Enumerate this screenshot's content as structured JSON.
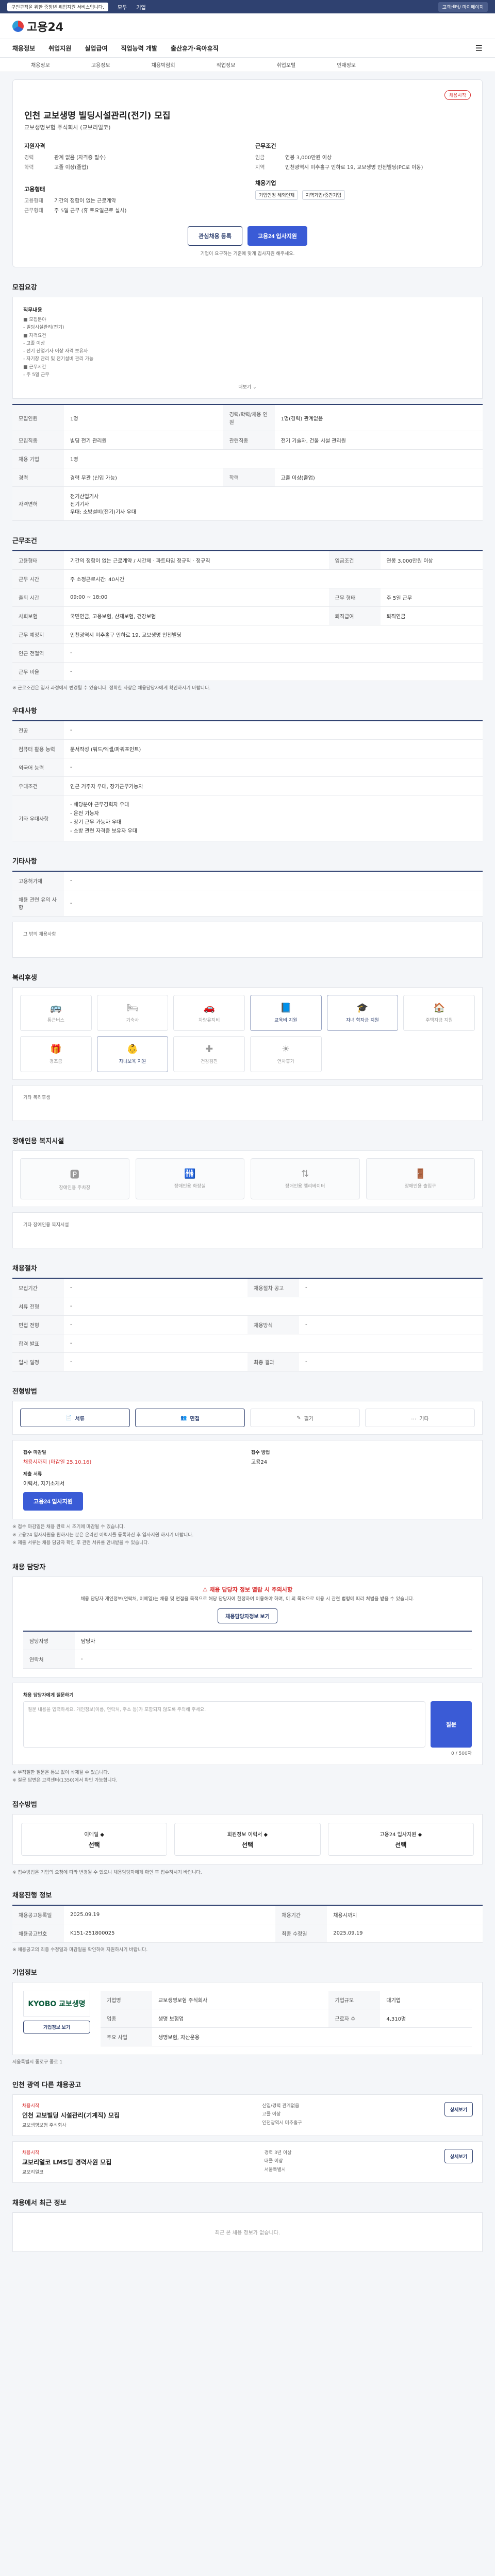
{
  "topbar": {
    "notice": "구인구직을 위한 중장년 취업지원 서비스입니다.",
    "link1": "모두",
    "link2": "기업",
    "right": "고객센터/ 마이페이지"
  },
  "logo": "고용24",
  "gnb": [
    "채용정보",
    "취업지원",
    "실업급여",
    "직업능력 개발",
    "출산휴가·육아휴직"
  ],
  "subnav": [
    "채용정보",
    "고용정보",
    "채용박람회",
    "직업정보",
    "취업포털",
    "인재정보"
  ],
  "hero": {
    "badge": "채용시작",
    "title": "인천 교보생명 빌딩시설관리(전기) 모집",
    "company": "교보생명보험 주식회사 (교보리얼코)",
    "left_title": "지원자격",
    "left": [
      {
        "k": "경력",
        "v": "관계 없음 (자격증 필수)"
      },
      {
        "k": "학력",
        "v": "고졸 이상(졸업)"
      }
    ],
    "right_title": "근무조건",
    "right": [
      {
        "k": "임금",
        "v": "연봉 3,000만원 이상"
      },
      {
        "k": "지역",
        "v": "인천광역시 미추홀구 인하로 19, 교보생명 인천빌딩(PC로 이동)"
      }
    ],
    "left2_title": "고용형태",
    "left2": [
      {
        "k": "고용형태",
        "v": "기간의 정함이 없는 근로계약"
      },
      {
        "k": "근무형태",
        "v": "주 5일 근무 (휴 토요일근로 실시)"
      }
    ],
    "right2_title": "채용기업",
    "chips": [
      "기업인정 해외인재",
      "지역기업/중견기업"
    ],
    "btn_save": "관심채용 등록",
    "btn_apply": "고용24 입사지원",
    "note": "기업이 요구하는 기준에 맞게 입사지원 해주세요."
  },
  "sections": {
    "recruit": "모집요강",
    "work": "근무조건",
    "prefer": "우대사항",
    "etc": "기타사항",
    "welfare": "복리후생",
    "disability": "장애인용 복지시설",
    "hr": "채용절차",
    "method": "전형방법",
    "contact": "채용 담당자",
    "apply": "접수방법",
    "status": "채용진행 정보",
    "company": "기업정보",
    "related": "인천 광역 다른 채용공고",
    "viewed": "채용에서 최근 정보"
  },
  "recruit_job": {
    "title": "직무내용",
    "lines": [
      "■ 모집분야",
      " - 빌딩시설관리(전기)",
      "■ 자격요건",
      " - 고졸 이상",
      " - 전기 산업기사 이상 자격 보유자",
      " - 자기장 관리 및 전기설비 관리 가능",
      "■ 근무시간",
      " - 주 5일 근무"
    ],
    "more": "더보기"
  },
  "recruit_rows": [
    {
      "k": "모집인원",
      "v": "1명",
      "k2": "경력/학력/채용 인원",
      "v2": "1명(경력) 관계없음"
    },
    {
      "k": "모집직종",
      "v": "빌딩 전기 관리원",
      "k2": "관련직종",
      "v2": "전기 기술자, 건물 시설 관리원"
    },
    {
      "k": "채용 기업",
      "v": "1명",
      "k2": "",
      "v2": ""
    },
    {
      "k": "경력",
      "v": "경력 무관 (신입 가능)",
      "k2": "학력",
      "v2": "고졸 이상(졸업)"
    },
    {
      "k": "자격면허",
      "v": "전기산업기사\n전기기사\n우대: 소방설비(전기)기사 우대",
      "k2": "",
      "v2": ""
    }
  ],
  "work_rows": [
    {
      "k": "고용형태",
      "v": "기간의 정함이 없는 근로계약 / 시간제 · 파트타임 정규직 · 정규직",
      "k2": "임금조건",
      "v2": "연봉 3,000만원 이상"
    },
    {
      "k": "근무 시간",
      "v": "주 소정근로시간: 40시간",
      "k2": "",
      "v2": ""
    },
    {
      "k": "출퇴 시간",
      "v": "09:00 ~ 18:00",
      "k2": "근무 형태",
      "v2": "주 5일 근무"
    },
    {
      "k": "사회보험",
      "v": "국민연금, 고용보험, 산재보험, 건강보험",
      "k2": "퇴직급여",
      "v2": "퇴직연금"
    },
    {
      "k": "근무 예정지",
      "v": "인천광역시 미추홀구 인하로 19, 교보생명 인천빌딩",
      "k2": "",
      "v2": ""
    },
    {
      "k": "인근 전철역",
      "v": "-",
      "k2": "",
      "v2": ""
    },
    {
      "k": "근무 비율",
      "v": "-",
      "k2": "",
      "v2": ""
    }
  ],
  "work_note": "※ 근로조건은 입사 과정에서 변경될 수 있습니다. 정확한 사항은 채용담당자에게 확인하시기 바랍니다.",
  "prefer_rows": [
    {
      "k": "전공",
      "v": "-"
    },
    {
      "k": "컴퓨터 활용 능력",
      "v": "문서작성 (워드/엑셀/파워포인트)"
    },
    {
      "k": "외국어 능력",
      "v": "-"
    },
    {
      "k": "우대조건",
      "v": "인근 거주자 우대, 장기근무가능자"
    },
    {
      "k": "기타 우대사항",
      "v": "- 해당분야 근무경력자 우대\n- 운전 가능자\n- 장기 근무 가능자 우대\n- 소방 관련 자격증 보유자 우대"
    }
  ],
  "etc_rows": [
    {
      "k": "고용허가제",
      "v": "-"
    },
    {
      "k": "채용 관련 유의 사항",
      "v": "-"
    }
  ],
  "etc_more_label": "그 밖의 채용사항",
  "welfare": [
    {
      "icon": "home",
      "label": "통근버스",
      "on": false
    },
    {
      "icon": "meal",
      "label": "기숙사",
      "on": false
    },
    {
      "icon": "car",
      "label": "차량유지비",
      "on": false
    },
    {
      "icon": "edu",
      "label": "교육비 지원",
      "on": true
    },
    {
      "icon": "graduate",
      "label": "자녀 학자금 지원",
      "on": true
    },
    {
      "icon": "house",
      "label": "주택자금 지원",
      "on": false
    },
    {
      "icon": "medical",
      "label": "경조금",
      "on": false
    },
    {
      "icon": "baby",
      "label": "자녀보육 지원",
      "on": true
    },
    {
      "icon": "health",
      "label": "건강검진",
      "on": false
    },
    {
      "icon": "vacation",
      "label": "연차휴가",
      "on": false
    }
  ],
  "welfare_etc": "기타 복리후생",
  "disability": [
    "장애인용 주차장",
    "장애인용 화장실",
    "장애인용 엘리베이터",
    "장애인용 출입구"
  ],
  "disability_etc": "기타 장애인용 복지시설",
  "hr_rows": [
    {
      "k": "모집기간",
      "v": "-",
      "k2": "채용절차 공고",
      "v2": "-"
    },
    {
      "k": "서류 전형",
      "v": "-",
      "k2": "",
      "v2": ""
    },
    {
      "k": "면접 전형",
      "v": "-",
      "k2": "채용방식",
      "v2": "-"
    },
    {
      "k": "합격 발표",
      "v": "-",
      "k2": "",
      "v2": ""
    },
    {
      "k": "입사 일정",
      "v": "-",
      "k2": "최종 결과",
      "v2": "-"
    }
  ],
  "method_items": [
    "서류",
    "면접",
    "필기",
    "기타"
  ],
  "method_info": {
    "deadline_label": "접수 마감일",
    "deadline": "채용시까지 (마감일 25.10.16)",
    "way_label": "접수 방법",
    "way": "고용24",
    "doc_label": "제출 서류",
    "doc": "이력서, 자기소개서",
    "apply_btn": "고용24 입사지원"
  },
  "method_notes": [
    "※ 접수 마감일은 채용 완료 시 조기에 마감될 수 있습니다.",
    "※ 고용24 입사지원을 원하시는 분은 온라인 이력서를 등록하신 후 입사지원 하시기 바랍니다.",
    "※ 제출 서류는 채용 담당자 확인 후 관련 서류를 안내받을 수 있습니다."
  ],
  "contact": {
    "head": "채용 담당자 정보 열람 시 주의사항",
    "desc": "채용 담당자 개인정보(연락처, 이메일)는 채용 및 면접을 목적으로 해당 담당자에 한정하여 이용해야 하며, 이 외 목적으로 이용 시 관련 법령에 따라 처벌을 받을 수 있습니다.",
    "btn": "채용담당자정보 보기",
    "name_label": "담당자명",
    "name": "담당자",
    "phone_label": "연락처",
    "phone": "-",
    "qna_label": "채용 담당자에게 질문하기",
    "qna_placeholder": "질문 내용을 입력하세요. 개인정보(이름, 연락처, 주소 등)가 포함되지 않도록 주의해 주세요.",
    "counter": "0 / 500자",
    "qna_btn": "질문"
  },
  "contact_notes": [
    "※ 부적절한 질문은 통보 없이 삭제될 수 있습니다.",
    "※ 질문 답변은 고객센터(1350)에서 확인 가능합니다."
  ],
  "apply_items": [
    {
      "label": "이메일 ◆",
      "value": "선택"
    },
    {
      "label": "회원정보 이력서 ◆",
      "value": "선택"
    },
    {
      "label": "고용24 입사지원 ◆",
      "value": "선택"
    }
  ],
  "apply_note": "※ 접수방법은 기업의 요청에 따라 변경될 수 있으니 채용담당자에게 확인 후 접수하시기 바랍니다.",
  "status_rows": [
    {
      "k": "채용공고등록일",
      "v": "2025.09.19",
      "k2": "채용기간",
      "v2": "채용시까지"
    },
    {
      "k": "채용공고번호",
      "v": "K151-251800025",
      "k2": "최종 수정일",
      "v2": "2025.09.19"
    }
  ],
  "status_note": "※ 채용공고의 최종 수정일과 마감일을 확인하여 지원하시기 바랍니다.",
  "company": {
    "logo": "KYOBO 교보생명",
    "btn": "기업정보 보기",
    "rows": [
      {
        "k": "기업명",
        "v": "교보생명보험 주식회사"
      },
      {
        "k": "업종",
        "v": "생명 보험업"
      },
      {
        "k": "주요 사업",
        "v": "생명보험, 자산운용"
      },
      {
        "k": "기업규모",
        "v": "대기업"
      },
      {
        "k": "근로자 수",
        "v": "4,310명"
      }
    ],
    "address": "서울특별시 종로구 종로 1"
  },
  "related": [
    {
      "badge": "채용시작",
      "title": "인천 교보빌딩 시설관리(기계직) 모집",
      "company": "교보생명보험 주식회사",
      "cond1": "신입/경력 관계없음",
      "cond2": "고졸 이상",
      "cond3": "인천광역시 미추홀구",
      "btn": "상세보기"
    },
    {
      "badge": "채용시작",
      "title": "교보리얼코 LMS팀 경력사원 모집",
      "company": "교보리얼코",
      "cond1": "경력 3년 이상",
      "cond2": "대졸 이상",
      "cond3": "서울특별시",
      "btn": "상세보기"
    }
  ],
  "viewed_empty": "최근 본 채용 정보가 없습니다."
}
